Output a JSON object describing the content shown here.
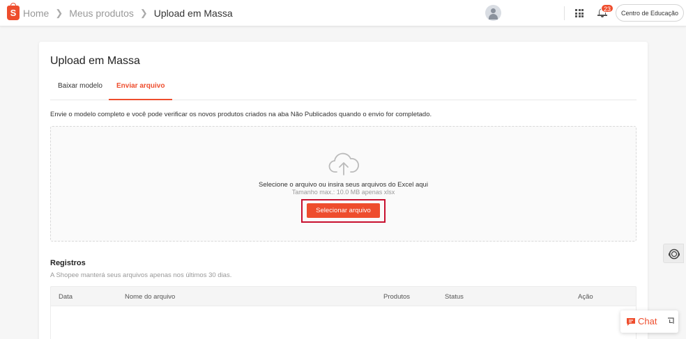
{
  "header": {
    "logo_letter": "S",
    "breadcrumbs": [
      "Home",
      "Meus produtos",
      "Upload em Massa"
    ],
    "notification_count": "23",
    "education_button": "Centro de Educação"
  },
  "page": {
    "title": "Upload em Massa",
    "tabs": [
      {
        "label": "Baixar modelo",
        "active": false
      },
      {
        "label": "Enviar arquivo",
        "active": true
      }
    ],
    "description": "Envie o modelo completo e você pode verificar os novos produtos criados na aba Não Publicados quando o envio for completado.",
    "dropzone": {
      "main_text": "Selecione o arquivo ou insira seus arquivos do Excel aqui",
      "sub_text": "Tamanho max.: 10.0 MB apenas xlsx",
      "button_label": "Selecionar arquivo"
    },
    "records": {
      "title": "Registros",
      "subtitle": "A Shopee manterá seus arquivos apenas nos últimos 30 dias.",
      "columns": [
        "Data",
        "Nome do arquivo",
        "Produtos",
        "Status",
        "Ação"
      ]
    }
  },
  "chat": {
    "label": "Chat"
  },
  "colors": {
    "accent": "#ee4d2d",
    "highlight_border": "#c8102e"
  },
  "icons": [
    "shopee-logo-icon",
    "chevron-right-icon",
    "user-avatar-icon",
    "apps-grid-icon",
    "bell-icon",
    "cloud-upload-icon",
    "headset-icon",
    "chat-bubble-icon",
    "minimize-icon"
  ]
}
